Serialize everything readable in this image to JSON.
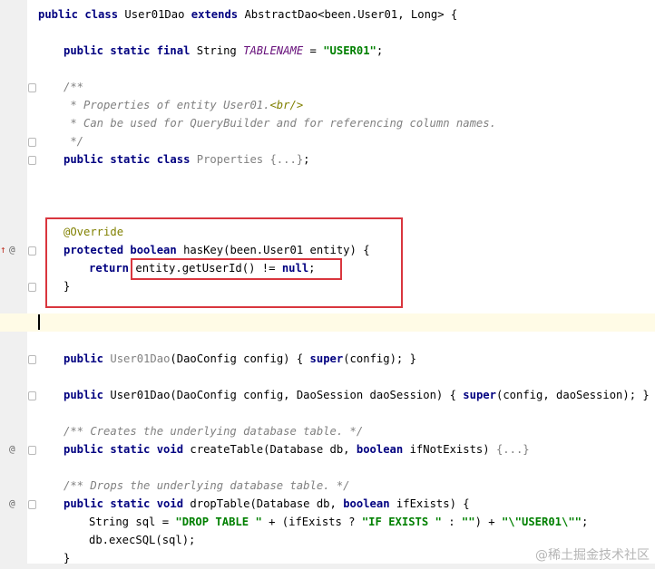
{
  "editor": {
    "lines": {
      "class_decl": {
        "kw1": "public class ",
        "name": "User01Dao ",
        "kw2": "extends ",
        "rest": "AbstractDao<been.User01, Long> {"
      },
      "tablename": {
        "kw": "public static final ",
        "type": "String ",
        "field": "TABLENAME",
        "eq": " = ",
        "value": "\"USER01\"",
        "end": ";"
      },
      "doc_open": "/**",
      "doc_line1_a": " * Properties of entity User01.",
      "doc_line1_tag": "<br/>",
      "doc_line2": " * Can be used for QueryBuilder and for referencing column names.",
      "doc_close": " */",
      "properties": {
        "kw": "public static class ",
        "name": "Properties ",
        "body": "{...}",
        "end": ";"
      },
      "override": "@Override",
      "haskey": {
        "kw": "protected boolean ",
        "sig": "hasKey(been.User01 entity) {"
      },
      "return": {
        "kw": "return ",
        "expr": "entity.getUserId() != ",
        "null": "null",
        "end": ";"
      },
      "close_brace": "}",
      "ctor1": {
        "kw": "public ",
        "name": "User01Dao",
        "args": "(DaoConfig config) ",
        "body_open": "{ ",
        "super": "super",
        "call": "(config); ",
        "body_close": "}"
      },
      "ctor2": {
        "kw": "public ",
        "name": "User01Dao",
        "args": "(DaoConfig config, DaoSession daoSession) ",
        "body_open": "{ ",
        "super": "super",
        "call": "(config, daoSession); ",
        "body_close": "}"
      },
      "create_doc": "/** Creates the underlying database table. */",
      "create": {
        "kw": "public static void ",
        "sig1": "createTable(Database db, ",
        "bool": "boolean ",
        "sig2": "ifNotExists) ",
        "body": "{...}"
      },
      "drop_doc": "/** Drops the underlying database table. */",
      "drop": {
        "kw": "public static void ",
        "sig1": "dropTable(Database db, ",
        "bool": "boolean ",
        "sig2": "ifExists) {"
      },
      "sql": {
        "type": "String sql = ",
        "s1": "\"DROP TABLE \"",
        "p1": " + (ifExists ? ",
        "s2": "\"IF EXISTS \"",
        "p2": " : ",
        "s3": "\"\"",
        "p3": ") + ",
        "s4": "\"\\\"USER01\\\"\"",
        "end": ";"
      },
      "exec": "db.execSQL(sql);",
      "partial_brace": "}"
    },
    "gutter_icons": {
      "override_up": "↑",
      "at": "@"
    }
  },
  "watermark": "@稀土掘金技术社区",
  "colors": {
    "highlight_box": "#d9363e",
    "keyword": "#000080",
    "string": "#008000",
    "comment": "#808080"
  }
}
